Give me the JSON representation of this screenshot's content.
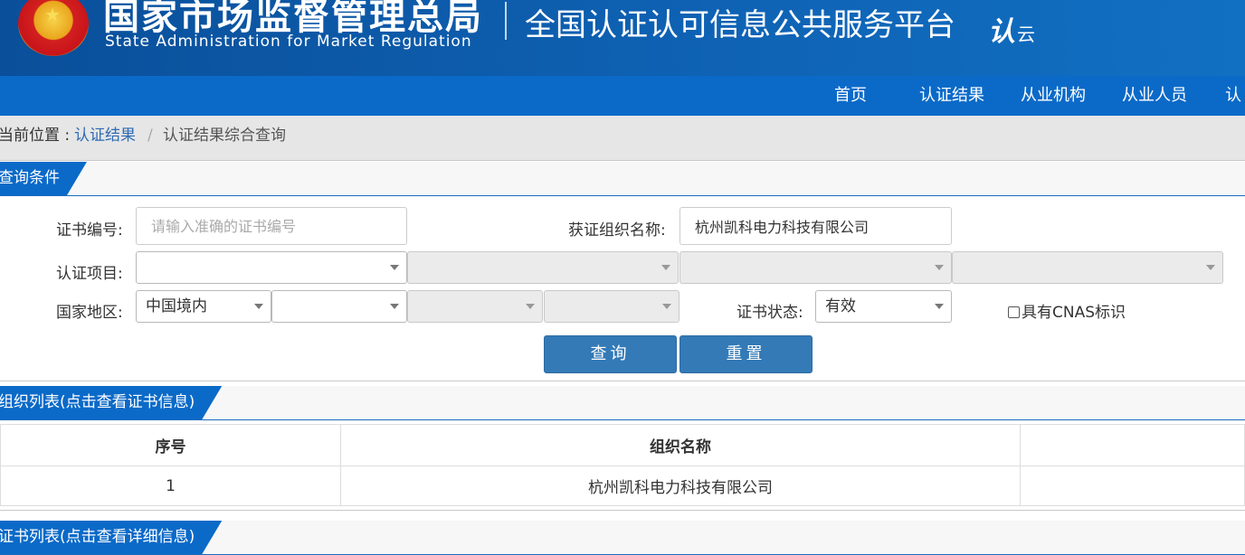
{
  "header": {
    "org_name_cn": "国家市场监督管理总局",
    "org_name_en": "State Administration  for  Market Regulation",
    "platform_title": "全国认证认可信息公共服务平台",
    "logo_text": "认",
    "logo_sub": "云"
  },
  "nav": {
    "items": [
      "首页",
      "认证结果",
      "从业机构",
      "从业人员",
      "认"
    ]
  },
  "breadcrumb": {
    "prefix": "当前位置 :",
    "link": "认证结果",
    "separator": "/",
    "current": "认证结果综合查询"
  },
  "query_section": {
    "title": "查询条件",
    "cert_no_label": "证书编号:",
    "cert_no_placeholder": "请输入准确的证书编号",
    "org_name_label": "获证组织名称:",
    "org_name_value": "杭州凯科电力科技有限公司",
    "project_label": "认证项目:",
    "region_label": "国家地区:",
    "region_value": "中国境内",
    "status_label": "证书状态:",
    "status_value": "有效",
    "cnas_label": "具有CNAS标识",
    "search_button": "查询",
    "reset_button": "重置"
  },
  "org_list": {
    "title": "组织列表(点击查看证书信息)",
    "columns": [
      "序号",
      "组织名称",
      ""
    ],
    "rows": [
      {
        "index": "1",
        "name": "杭州凯科电力科技有限公司"
      }
    ]
  },
  "cert_list": {
    "title": "证书列表(点击查看详细信息)"
  },
  "colors": {
    "header_blue": "#0d5aa7",
    "nav_blue": "#0b6ac8",
    "button_blue": "#337ab7",
    "link_blue": "#2e6bb5"
  }
}
